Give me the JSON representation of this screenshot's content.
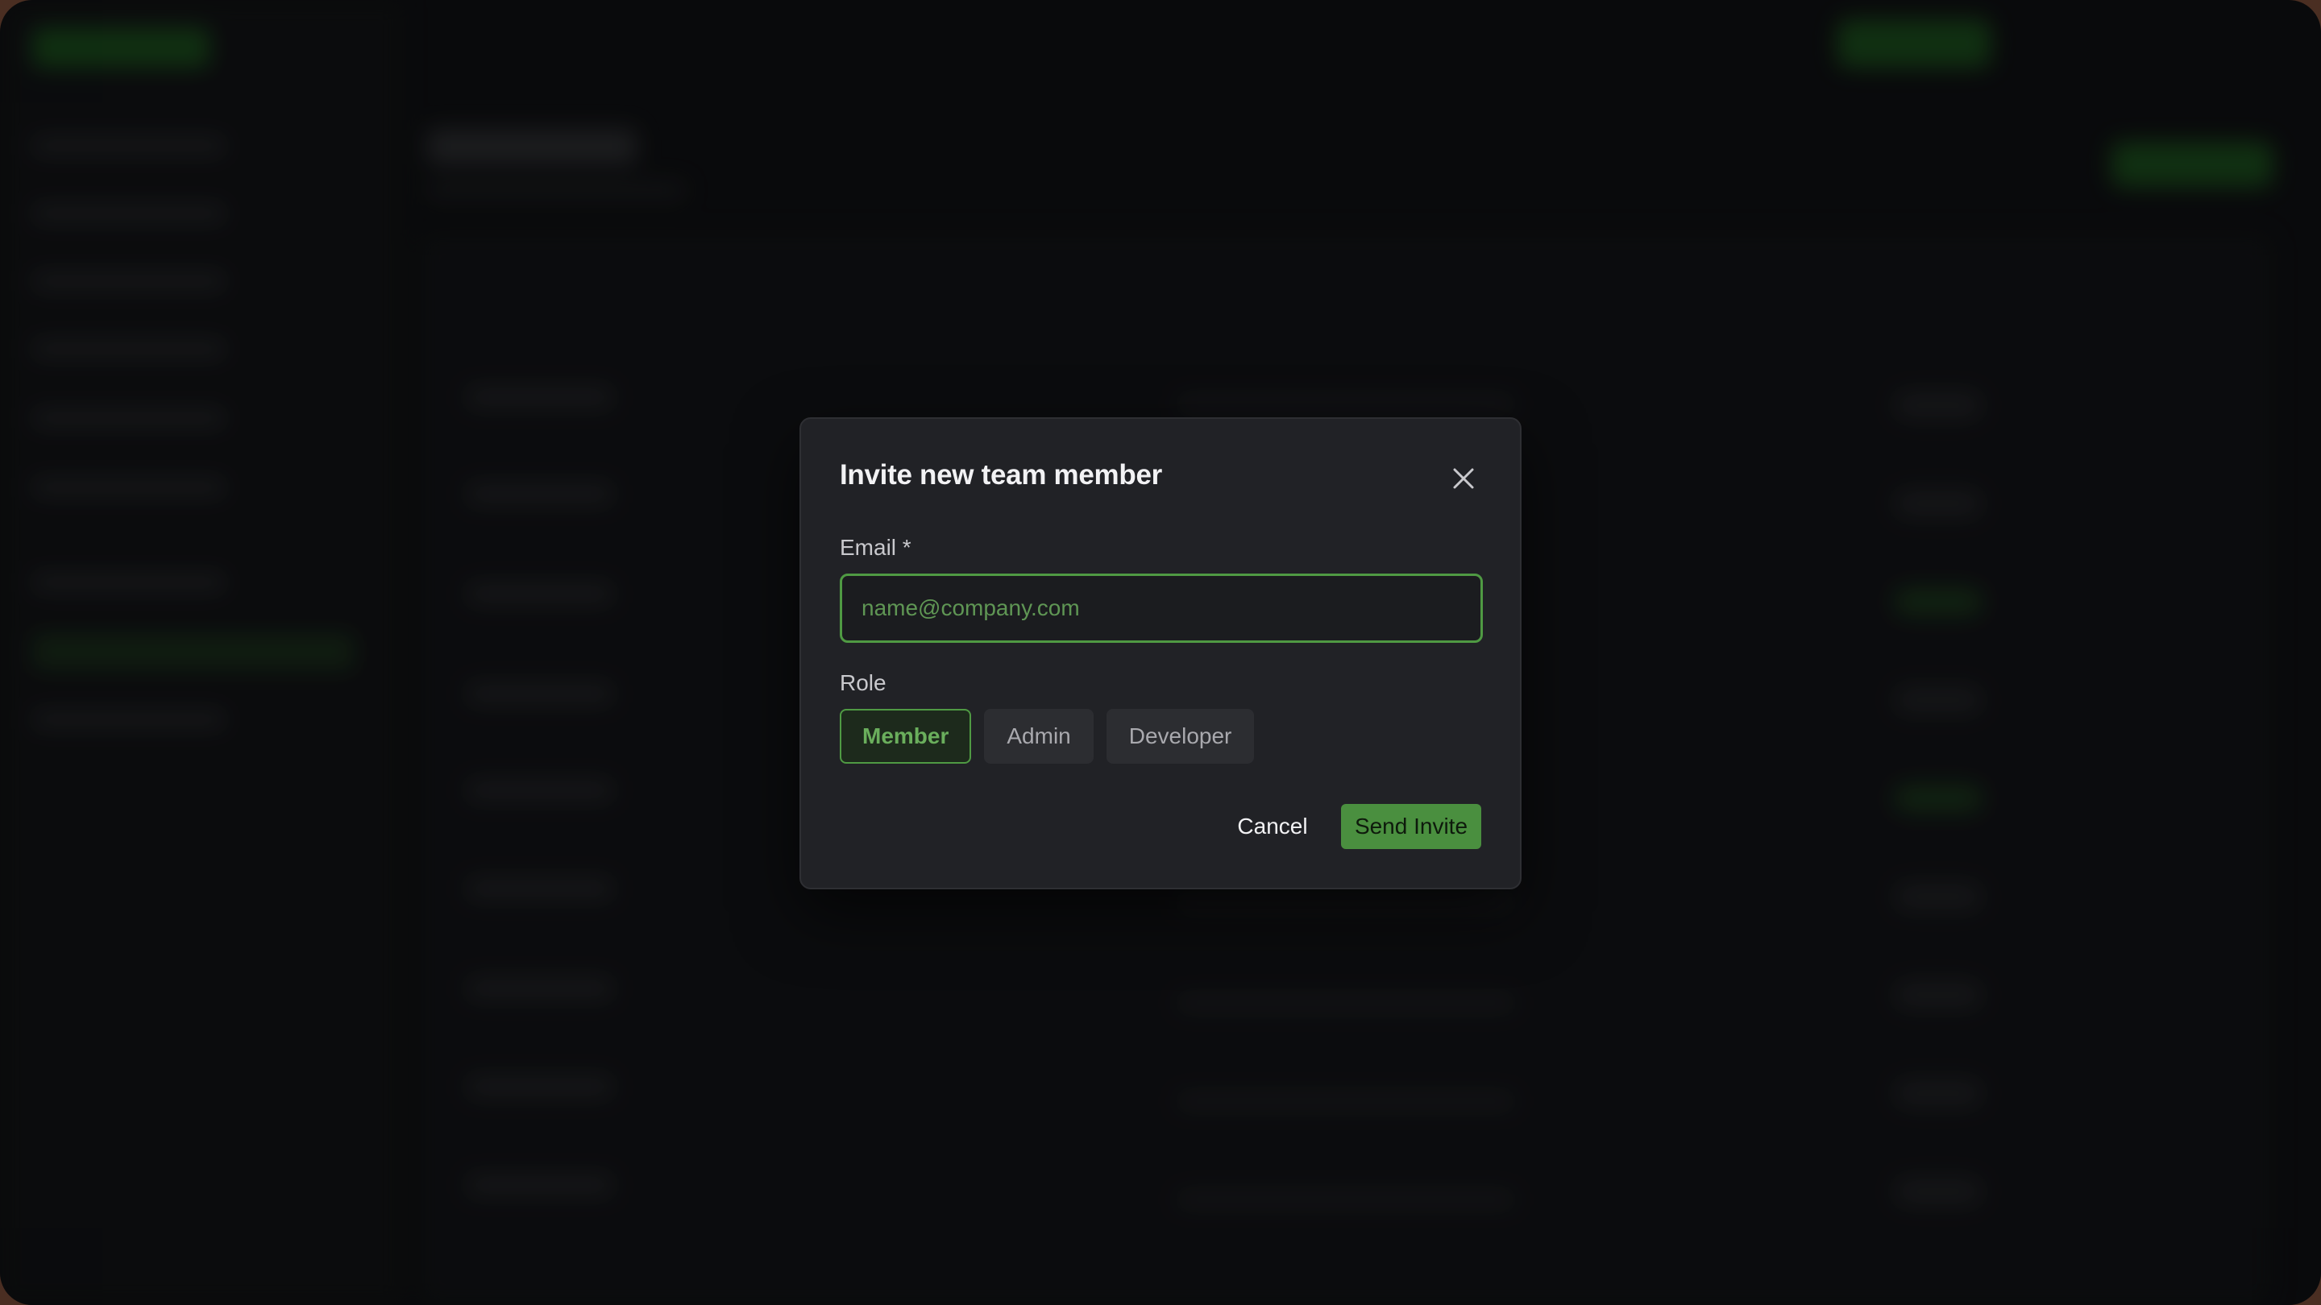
{
  "modal": {
    "title": "Invite new team member",
    "close_icon": "close-icon",
    "email": {
      "label": "Email *",
      "value": "",
      "placeholder": "name@company.com"
    },
    "role": {
      "label": "Role",
      "options": [
        "Member",
        "Admin",
        "Developer"
      ],
      "selected": "Member"
    },
    "cancel_label": "Cancel",
    "send_label": "Send Invite"
  },
  "colors": {
    "accent": "#4a8f3f",
    "accent_text": "#6aae5c",
    "modal_bg": "#212226",
    "backdrop": "#0d0e10"
  }
}
